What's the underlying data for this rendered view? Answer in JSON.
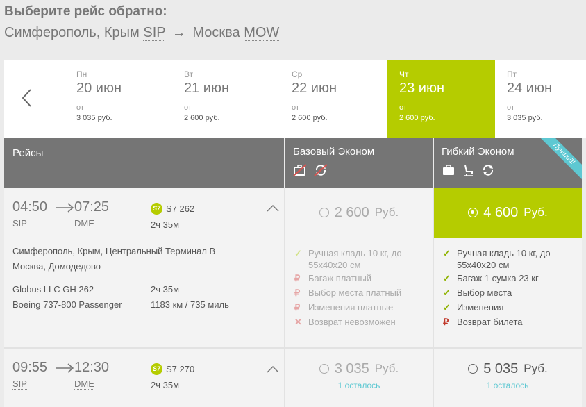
{
  "title": "Выберите рейс обратно:",
  "route": {
    "from": "Симферополь, Крым",
    "from_code": "SIP",
    "to": "Москва",
    "to_code": "MOW"
  },
  "dates": [
    {
      "dow": "Пн",
      "date": "20 июн",
      "ot": "от",
      "price": "3 035 руб."
    },
    {
      "dow": "Вт",
      "date": "21 июн",
      "ot": "от",
      "price": "2 600 руб."
    },
    {
      "dow": "Ср",
      "date": "22 июн",
      "ot": "от",
      "price": "2 600 руб."
    },
    {
      "dow": "Чт",
      "date": "23 июн",
      "ot": "от",
      "price": "2 600 руб.",
      "active": true
    },
    {
      "dow": "Пт",
      "date": "24 июн",
      "ot": "от",
      "price": "3 035 руб."
    }
  ],
  "header": {
    "flights": "Рейсы",
    "base_fare": "Базовый Эконом",
    "flex_fare": "Гибкий Эконом",
    "best_badge": "Лучший!"
  },
  "flights": [
    {
      "dep_time": "04:50",
      "arr_time": "07:25",
      "dep_code": "SIP",
      "arr_code": "DME",
      "airline_logo": "S7",
      "flight_no": "S7 262",
      "duration": "2ч 35м",
      "from_airport": "Симферополь, Крым, Центральный Терминал В",
      "to_airport": "Москва, Домодедово",
      "operator": "Globus LLC GH 262",
      "op_duration": "2ч 35м",
      "aircraft": "Boeing 737-800 Passenger",
      "distance": "1183 км / 735 миль",
      "base_price": "2 600",
      "base_currency": "Руб.",
      "flex_price": "4 600",
      "flex_currency": "Руб.",
      "base_features": [
        {
          "icon": "check-icon",
          "text": "Ручная кладь 10 кг, до 55x40x20 см"
        },
        {
          "icon": "ruble-icon",
          "text": "Багаж платный"
        },
        {
          "icon": "ruble-icon",
          "text": "Выбор места платный"
        },
        {
          "icon": "ruble-icon",
          "text": "Изменения платные"
        },
        {
          "icon": "cross-icon",
          "text": "Возврат невозможен"
        }
      ],
      "flex_features": [
        {
          "icon": "check-icon",
          "text": "Ручная кладь 10 кг, до 55x40x20 см"
        },
        {
          "icon": "check-icon",
          "text": "Багаж 1 сумка 23 кг"
        },
        {
          "icon": "check-icon",
          "text": "Выбор места"
        },
        {
          "icon": "check-icon",
          "text": "Изменения"
        },
        {
          "icon": "ruble-icon",
          "text": "Возврат билета"
        }
      ]
    },
    {
      "dep_time": "09:55",
      "arr_time": "12:30",
      "dep_code": "SIP",
      "arr_code": "DME",
      "airline_logo": "S7",
      "flight_no": "S7 270",
      "duration": "2ч 35м",
      "base_price": "3 035",
      "base_currency": "Руб.",
      "base_left": "1 осталось",
      "flex_price": "5 035",
      "flex_currency": "Руб.",
      "flex_left": "1 осталось"
    }
  ],
  "colors": {
    "accent": "#b5cc00",
    "header": "#757575",
    "badge": "#5ec8d2"
  }
}
